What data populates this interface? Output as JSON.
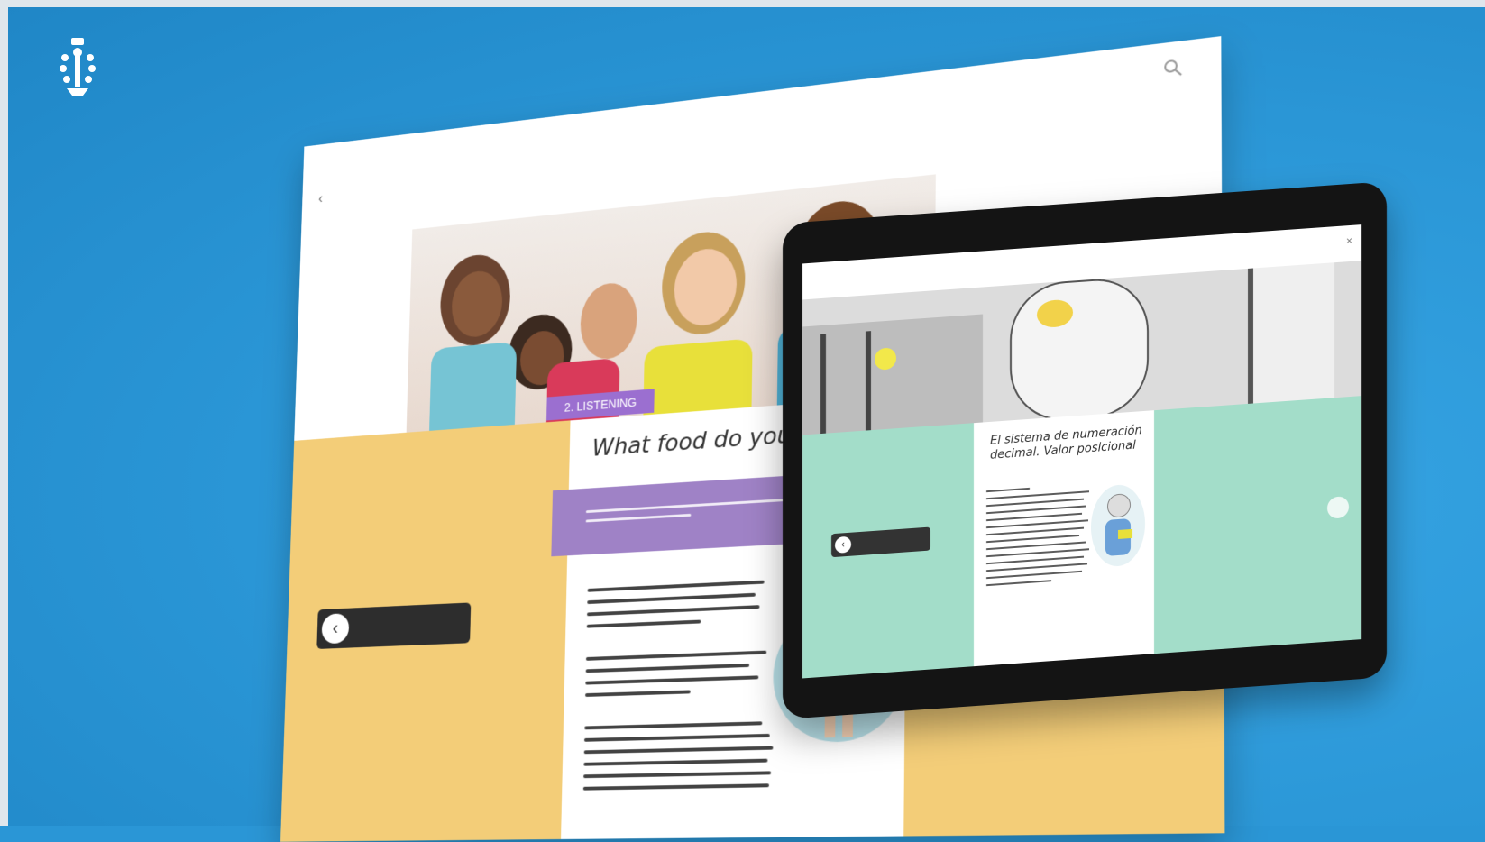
{
  "colors": {
    "background": "#2a96d6",
    "desktop_side": "#f3cd78",
    "desktop_band": "#9f82c6",
    "tablet_side": "#a3ddc9"
  },
  "logo": {
    "icon": "crest-icon"
  },
  "desktop": {
    "header": {
      "breadcrumb_top": "",
      "breadcrumb_bottom": "",
      "search_icon": "search-icon"
    },
    "hero": {
      "tag": "2. LISTENING"
    },
    "content": {
      "title": "What food do you like?",
      "band_text": ""
    },
    "prev_button": {
      "label": ""
    }
  },
  "tablet": {
    "header": {
      "breadcrumb": "",
      "close": "×"
    },
    "content": {
      "title": "El sistema de numeración decimal. Valor posicional"
    },
    "prev_button": {
      "label": ""
    }
  }
}
